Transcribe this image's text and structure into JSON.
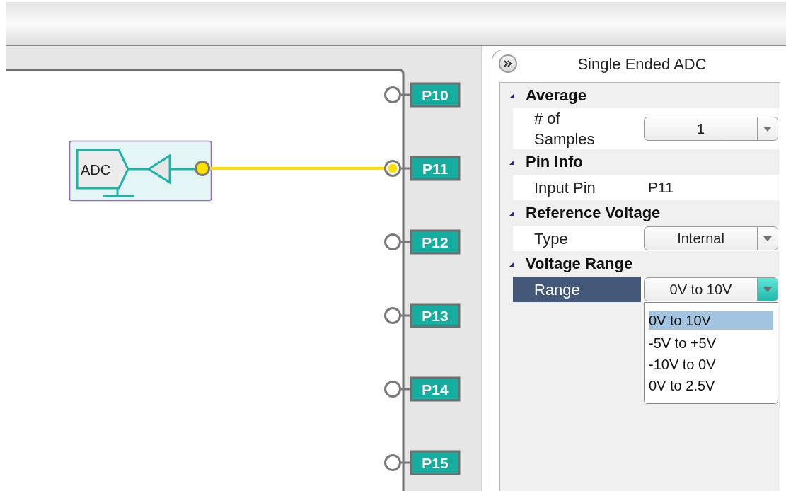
{
  "canvas": {
    "component": {
      "label": "ADC"
    },
    "pins": [
      {
        "label": "P10",
        "connected": false
      },
      {
        "label": "P11",
        "connected": true
      },
      {
        "label": "P12",
        "connected": false
      },
      {
        "label": "P13",
        "connected": false
      },
      {
        "label": "P14",
        "connected": false
      },
      {
        "label": "P15",
        "connected": false
      }
    ]
  },
  "panel": {
    "title": "Single Ended ADC",
    "categories": [
      {
        "label": "Average",
        "expanded": true,
        "properties": [
          {
            "name": "# of Samples",
            "kind": "dropdown",
            "value": "1",
            "selected": false,
            "open": false
          }
        ]
      },
      {
        "label": "Pin Info",
        "expanded": true,
        "properties": [
          {
            "name": "Input Pin",
            "kind": "text",
            "value": "P11",
            "selected": false
          }
        ]
      },
      {
        "label": "Reference Voltage",
        "expanded": true,
        "properties": [
          {
            "name": "Type",
            "kind": "dropdown",
            "value": "Internal",
            "selected": false,
            "open": false
          }
        ]
      },
      {
        "label": "Voltage Range",
        "expanded": true,
        "properties": [
          {
            "name": "Range",
            "kind": "dropdown",
            "value": "0V to 10V",
            "selected": true,
            "open": true,
            "options": [
              {
                "label": "0V to 10V",
                "selected": true
              },
              {
                "label": "-5V to +5V",
                "selected": false
              },
              {
                "label": "-10V to 0V",
                "selected": false
              },
              {
                "label": "0V to 2.5V",
                "selected": false
              }
            ]
          }
        ]
      }
    ]
  }
}
